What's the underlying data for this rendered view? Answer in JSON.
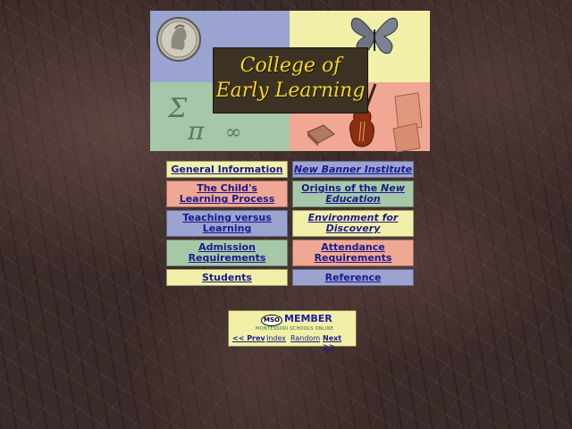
{
  "banner": {
    "title_line1": "College of",
    "title_line2": "Early Learning",
    "symbols": [
      "Σ",
      "π",
      "∞"
    ],
    "colors": {
      "blue": "#9ba3d0",
      "yellow": "#f2f0a8",
      "green": "#a6c8a8",
      "pink": "#f0a894",
      "title_bg": "#3c3224",
      "title_text": "#f2d52e"
    },
    "icons": [
      "coin-icon",
      "butterfly-icon",
      "violin-icon",
      "book-icon"
    ]
  },
  "nav": {
    "items": [
      {
        "label": "General Information",
        "name": "general-information"
      },
      {
        "label": "New Banner Institute",
        "name": "new-banner-institute"
      },
      {
        "label": "The Child's Learning Process",
        "name": "childs-learning-process"
      },
      {
        "label_prefix": "Origins of the ",
        "label_italic": "New",
        "label_suffix": "Education",
        "name": "origins-new-education"
      },
      {
        "label": "Teaching versus Learning",
        "name": "teaching-versus-learning"
      },
      {
        "label": "Environment for Discovery",
        "name": "environment-for-discovery"
      },
      {
        "label": "Admission Requirements",
        "name": "admission-requirements"
      },
      {
        "label": "Attendance Requirements",
        "name": "attendance-requirements"
      },
      {
        "label": "Students",
        "name": "students"
      },
      {
        "label": "Reference",
        "name": "reference"
      }
    ]
  },
  "footer": {
    "logo_text": "MSO",
    "member_label": "MEMBER",
    "org_name": "MONTESSORI SCHOOLS ONLINE",
    "links": {
      "prev": "<< Prev",
      "index": "Index",
      "random": "Random",
      "next": "Next >>"
    }
  }
}
